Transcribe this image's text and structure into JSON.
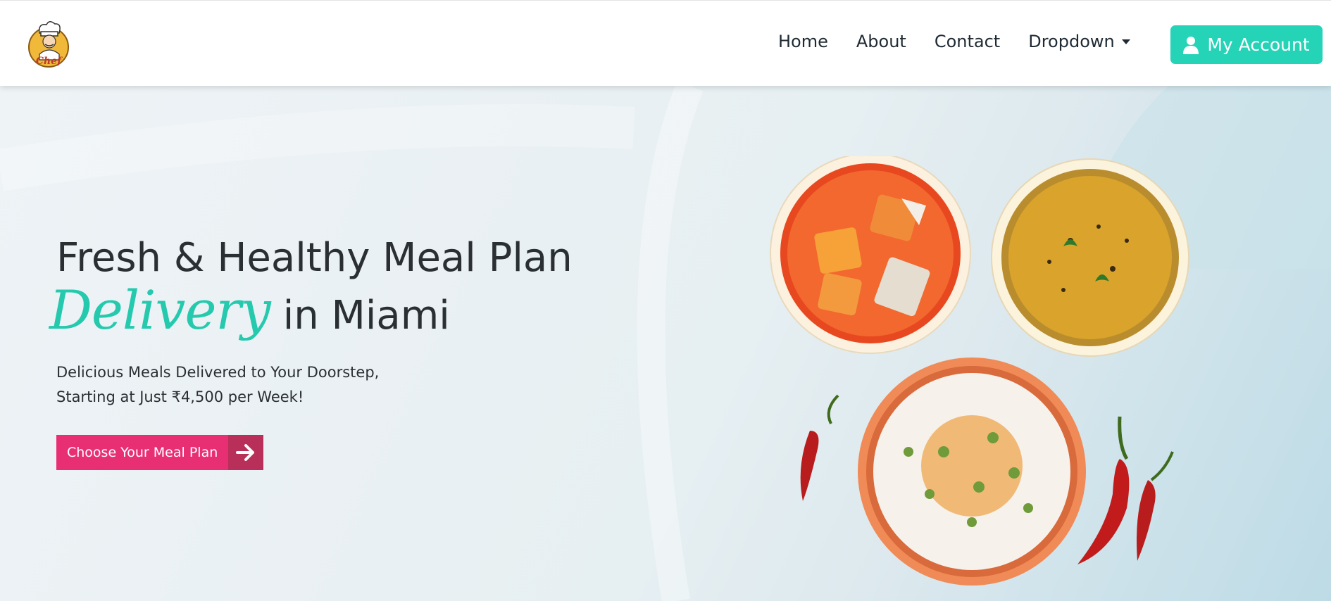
{
  "header": {
    "logo_icon": "chef-logo-icon",
    "logo_text": "Chef",
    "nav": [
      {
        "label": "Home"
      },
      {
        "label": "About"
      },
      {
        "label": "Contact"
      },
      {
        "label": "Dropdown"
      }
    ],
    "account_label": "My Account",
    "account_icon": "user-icon"
  },
  "hero": {
    "headline_line1": "Fresh & Healthy Meal Plan",
    "headline_script": "Delivery",
    "headline_line2_rest": "in Miami",
    "subtext": "Delicious Meals Delivered to Your Doorstep, Starting at Just ₹4,500 per Week!",
    "cta_label": "Choose Your Meal Plan",
    "cta_icon": "arrow-right-icon",
    "food_items": [
      "paneer-curry-bowl",
      "dal-bowl",
      "rice-pulao-plate",
      "red-chili-left",
      "red-chili-right-large",
      "red-chili-right-small"
    ]
  },
  "colors": {
    "accent_teal": "#25d3b7",
    "script_teal": "#25c9ad",
    "cta_pink": "#e92f73",
    "cta_arrow_bg": "#b8305a",
    "text_dark": "#2a2f33"
  }
}
